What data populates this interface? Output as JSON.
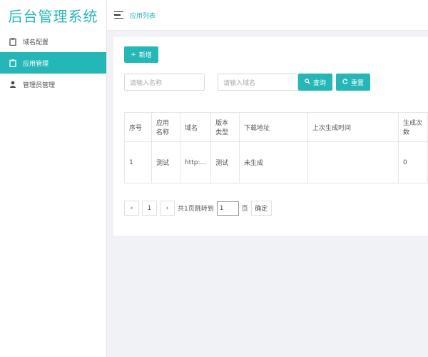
{
  "app": {
    "title": "后台管理系统"
  },
  "sidebar": {
    "items": [
      {
        "label": "域名配置",
        "icon": "clipboard-icon",
        "active": false
      },
      {
        "label": "应用管理",
        "icon": "clipboard-icon",
        "active": true
      },
      {
        "label": "管理员管理",
        "icon": "user-icon",
        "active": false
      }
    ]
  },
  "header": {
    "breadcrumb": "应用列表"
  },
  "toolbar": {
    "add_label": "新增"
  },
  "search": {
    "name_placeholder": "请输入名称",
    "domain_placeholder": "请输入域名",
    "query_label": "查询",
    "reset_label": "重置"
  },
  "table": {
    "columns": [
      "序号",
      "应用名称",
      "域名",
      "版本类型",
      "下载地址",
      "上次生成时间",
      "生成次数"
    ],
    "rows": [
      [
        "1",
        "测试",
        "http:...",
        "测试",
        "未生成",
        "",
        "0"
      ]
    ]
  },
  "pagination": {
    "prev": "‹",
    "page": "1",
    "next": "›",
    "total_text": "共1页跳转到",
    "jump_value": "1",
    "page_unit": "页",
    "confirm_label": "确定"
  },
  "colors": {
    "accent": "#25b7b7",
    "brand": "#2ab6b6"
  }
}
